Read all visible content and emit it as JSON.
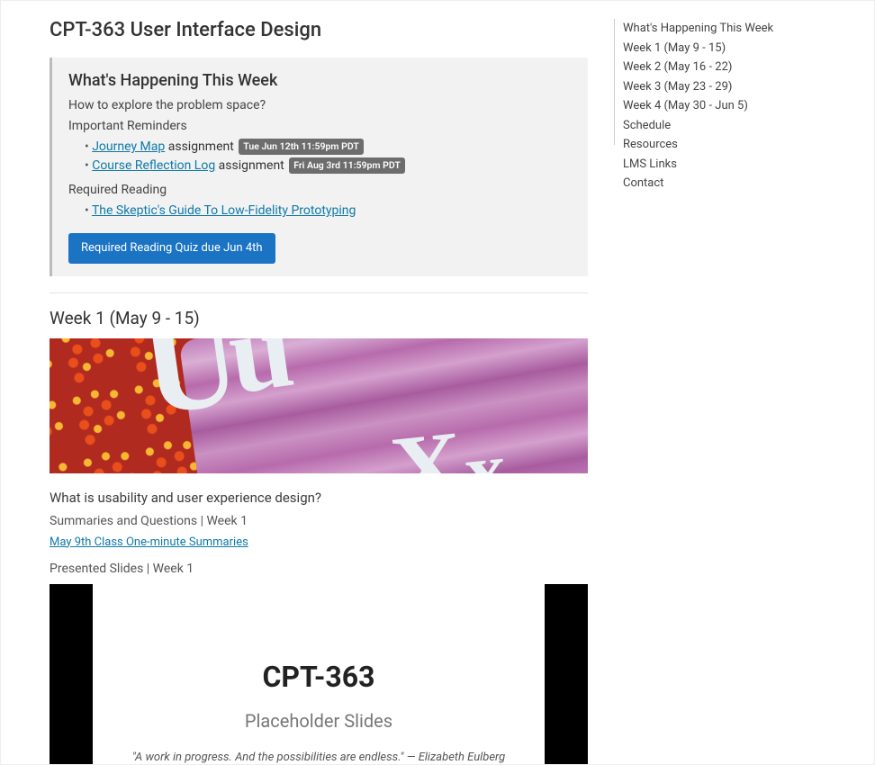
{
  "page": {
    "title": "CPT-363 User Interface Design"
  },
  "callout": {
    "heading": "What's Happening This Week",
    "subtitle": "How to explore the problem space?",
    "reminders_label": "Important Reminders",
    "reminders": [
      {
        "link": "Journey Map",
        "suffix": " assignment ",
        "badge": "Tue Jun 12th 11:59pm PDT"
      },
      {
        "link": "Course Reflection Log",
        "suffix": " assignment ",
        "badge": "Fri Aug 3rd 11:59pm PDT"
      }
    ],
    "reading_label": "Required Reading",
    "readings": [
      {
        "link": "The Skeptic's Guide To Low-Fidelity Prototyping"
      }
    ],
    "button": "Required Reading Quiz due Jun 4th"
  },
  "week1": {
    "title": "Week 1 (May 9 - 15)",
    "question": "What is usability and user experience design?",
    "summaries_label": "Summaries and Questions | Week 1",
    "summary_link": "May 9th Class One-minute Summaries",
    "slides_label": "Presented Slides | Week 1"
  },
  "slides": {
    "title": "CPT-363",
    "subtitle": "Placeholder Slides",
    "quote": "\"A work in progress. And the possibilities are endless.\" — Elizabeth Eulberg"
  },
  "sidebar": {
    "items": [
      "What's Happening This Week",
      "Week 1 (May 9 - 15)",
      "Week 2 (May 16 - 22)",
      "Week 3 (May 23 - 29)",
      "Week 4 (May 30 - Jun 5)",
      "Schedule",
      "Resources",
      "LMS Links",
      "Contact"
    ]
  }
}
